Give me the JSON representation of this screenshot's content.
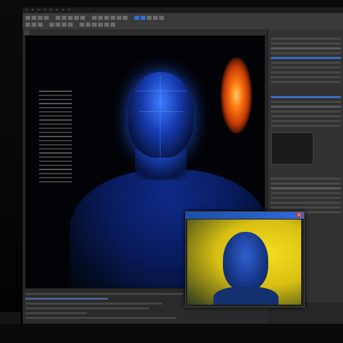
{
  "colors": {
    "accent": "#2d6fd6",
    "canvas_bg": "#020306",
    "glow_blue": "#3c7dff",
    "fire_orange": "#ff7a12",
    "preview_yellow": "#f4df1e"
  },
  "icons": {
    "toolbar_groups": 3,
    "tool_buttons_row1": 22,
    "tool_buttons_row2": 14
  }
}
